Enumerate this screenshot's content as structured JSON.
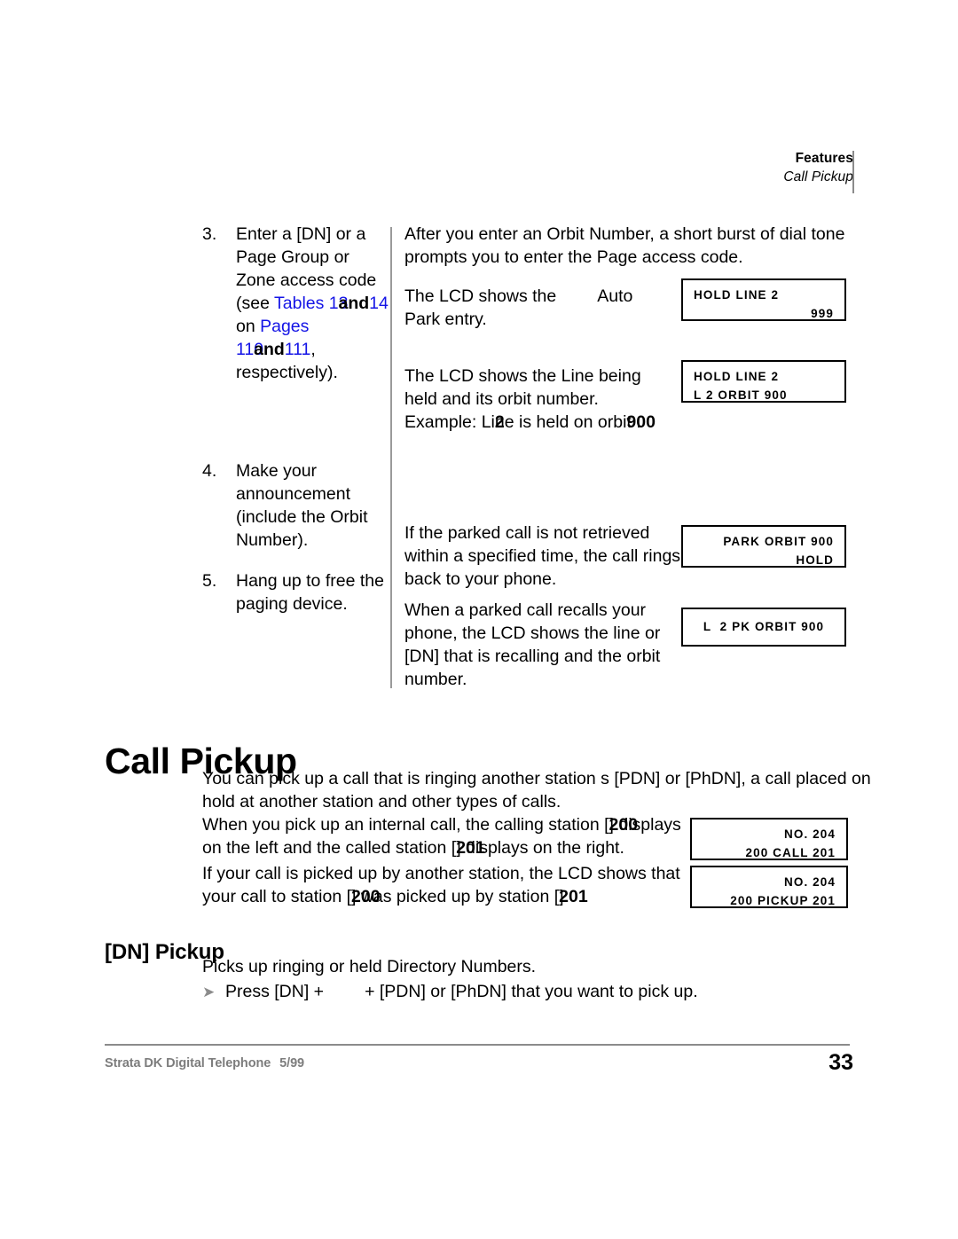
{
  "header": {
    "title": "Features",
    "subtitle": "Call Pickup"
  },
  "procedure": {
    "steps": [
      {
        "number": "3.",
        "text_part1": "Enter a [DN] or a Page Group or Zone access code (see ",
        "link1": "Tables 13",
        "mid1": "and",
        "link2": "14",
        "mid2": " on ",
        "link3": "Pages 110",
        "mid3": "and",
        "link4": "111",
        "tail": ", respectively)."
      },
      {
        "number": "4.",
        "text": "Make your announcement (include the Orbit Number)."
      },
      {
        "number": "5.",
        "text": "Hang up to free the paging device."
      }
    ],
    "right_column": [
      {
        "id": "orbit-dial-tone",
        "text": "After you enter an Orbit Number, a short burst of dial tone prompts you to enter the Page access code."
      },
      {
        "id": "auto-park-entry",
        "lead": "The LCD shows the",
        "emphasis": "Auto Park",
        "tail": "entry."
      },
      {
        "id": "line-held-orbit",
        "part1": "The LCD shows the Line being held and its orbit number. Example: Li",
        "bold1": "2",
        "part2": "ne is held on orbi",
        "bold2": "900",
        "part3": "t ."
      },
      {
        "id": "parked-call-rings-back",
        "text": "If the parked call is not retrieved within a specified time, the call rings back to your phone."
      },
      {
        "id": "parked-call-recall",
        "text": "When a parked call recalls your phone, the LCD shows the line or [DN] that is recalling and the orbit number."
      }
    ]
  },
  "lcd_displays": [
    {
      "id": "hold-line-2-999",
      "lines": [
        {
          "text": "HOLD LINE 2",
          "align": "left"
        },
        {
          "text": "999",
          "align": "right"
        }
      ]
    },
    {
      "id": "hold-line-2-orbit-900",
      "lines": [
        {
          "text": "HOLD LINE 2",
          "align": "left"
        },
        {
          "text": "L 2 ORBIT 900",
          "align": "left"
        }
      ]
    },
    {
      "id": "park-orbit-900-hold",
      "lines": [
        {
          "text": "PARK ORBIT 900",
          "align": "right"
        },
        {
          "text": "HOLD",
          "align": "right"
        }
      ]
    },
    {
      "id": "pk-orbit-900",
      "lines": [
        {
          "text": "L  2 PK ORBIT 900",
          "align": "center"
        }
      ]
    },
    {
      "id": "no-204-200-call-201",
      "lines": [
        {
          "text": "NO. 204",
          "align": "right"
        },
        {
          "text": "200 CALL 201",
          "align": "right"
        }
      ]
    },
    {
      "id": "no-204-200-pickup-201",
      "lines": [
        {
          "text": "NO. 204",
          "align": "right"
        },
        {
          "text": "200 PICKUP 201",
          "align": "right"
        }
      ]
    }
  ],
  "call_pickup": {
    "heading": "Call Pickup",
    "intro": "You can pick up a call that is ringing another station s [PDN] or [PhDN], a call placed on hold at another station and other types of calls.",
    "internal_call": {
      "part1": "When you pick up an internal call, the calling station [",
      "bold1": "200",
      "part2": "] displays on the left and the called station [",
      "bold2": "201",
      "part3": "] displays on the right."
    },
    "picked_up": {
      "part1": "If your call is picked up by another station, the LCD shows that your call to station [",
      "bold1": "200",
      "part2": "] was picked up by station [",
      "bold2": "201",
      "part3": "]."
    }
  },
  "dn_pickup": {
    "heading": "[DN] Pickup",
    "description": "Picks up ringing or held Directory Numbers.",
    "bullet_icon": "right-triangle-bullet",
    "action_part1": "Press [DN] +",
    "action_part2": "+ [PDN] or [PhDN] that you want to pick up."
  },
  "footer": {
    "document": "Strata DK Digital Telephone",
    "date": "5/99",
    "page_number": "33"
  },
  "colors": {
    "link": "#1414e6",
    "rule": "#8b8b8b",
    "footer_text": "#7d7d7d",
    "bullet": "#8c8c8c"
  }
}
